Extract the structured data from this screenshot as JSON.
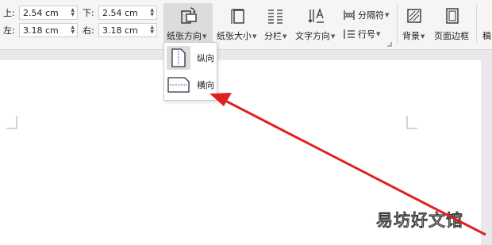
{
  "margins": {
    "top": {
      "label": "上:",
      "value": "2.54 cm"
    },
    "bottom": {
      "label": "下:",
      "value": "2.54 cm"
    },
    "left": {
      "label": "左:",
      "value": "3.18 cm"
    },
    "right": {
      "label": "右:",
      "value": "3.18 cm"
    }
  },
  "toolbar": {
    "orientation": "纸张方向",
    "paper_size": "纸张大小",
    "columns": "分栏",
    "text_direction": "文字方向",
    "separator": "分隔符",
    "line_number": "行号",
    "background": "背景",
    "page_border": "页面边框",
    "draft": "稿"
  },
  "orientation_menu": {
    "items": [
      {
        "label": "纵向",
        "icon": "portrait-page-icon",
        "selected": true
      },
      {
        "label": "横向",
        "icon": "landscape-page-icon",
        "selected": false
      }
    ]
  },
  "watermark": "易坊好文馆",
  "colors": {
    "accent": "#2a6bd6",
    "arrow": "#e02020"
  }
}
